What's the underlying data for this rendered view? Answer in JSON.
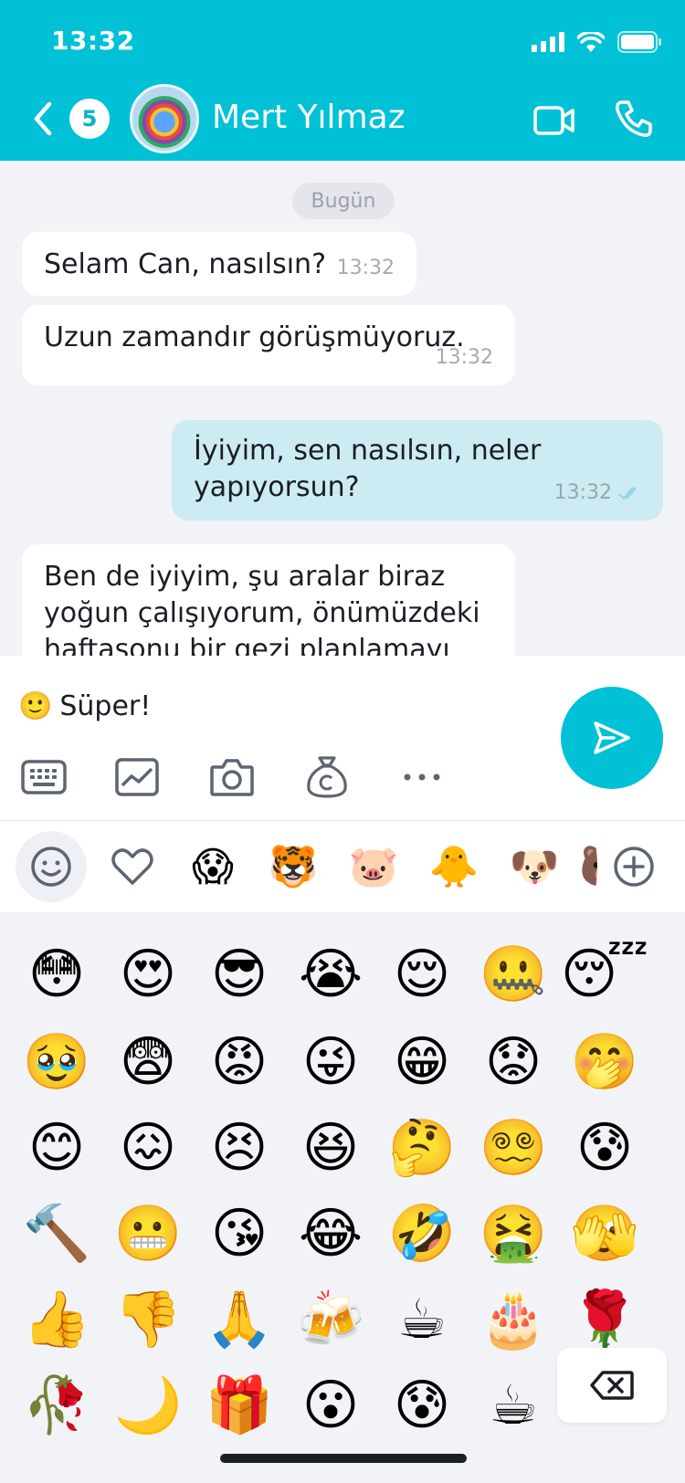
{
  "status": {
    "time": "13:32"
  },
  "header": {
    "badge_count": "5",
    "contact_name": "Mert Yılmaz",
    "colors": {
      "bar": "#00c1d6"
    }
  },
  "chat": {
    "date_label": "Bugün",
    "messages": [
      {
        "text": "Selam Can, nasılsın?",
        "time": "13:32",
        "direction": "in"
      },
      {
        "text": "Uzun zamandır görüşmüyoruz.",
        "time": "13:32",
        "direction": "in"
      },
      {
        "text_line1": "İyiyim, sen nasılsın, neler",
        "text_line2": "yapıyorsun?",
        "time": "13:32",
        "direction": "out",
        "read": true
      },
      {
        "text_line1": "Ben de iyiyim, şu aralar biraz",
        "text_line2": "yoğun çalışıyorum, önümüzdeki",
        "text_line3": "haftasonu bir gezi planlamayı",
        "direction": "in"
      }
    ]
  },
  "composer": {
    "draft_emoji": "🙂",
    "draft_text": "Süper!",
    "tools": [
      "keyboard-icon",
      "image-icon",
      "camera-icon",
      "money-bag-icon",
      "more-icon"
    ]
  },
  "emoji_tabs": [
    "smiley-icon",
    "heart-icon",
    "😱",
    "🐯",
    "🐷",
    "🐥",
    "🐶",
    "🐻",
    "add-icon"
  ],
  "emoji_grid": [
    [
      "😳",
      "😍",
      "😎",
      "😭",
      "😌",
      "🤐",
      "😴"
    ],
    [
      "🥹",
      "😨",
      "😡",
      "😜",
      "😁",
      "😟",
      "🤭"
    ],
    [
      "😊",
      "😖",
      "😣",
      "😆",
      "🤔",
      "😵‍💫",
      "😰"
    ],
    [
      "🔨",
      "😬",
      "😘",
      "😂",
      "🤣",
      "🤮",
      "🫣"
    ],
    [
      "👍",
      "👎",
      "🙏",
      "🍻",
      "☕",
      "🎂",
      "🌹"
    ],
    [
      "🥀",
      "🌙",
      "🎁",
      "😮",
      "😰",
      "☕",
      "👐"
    ]
  ]
}
